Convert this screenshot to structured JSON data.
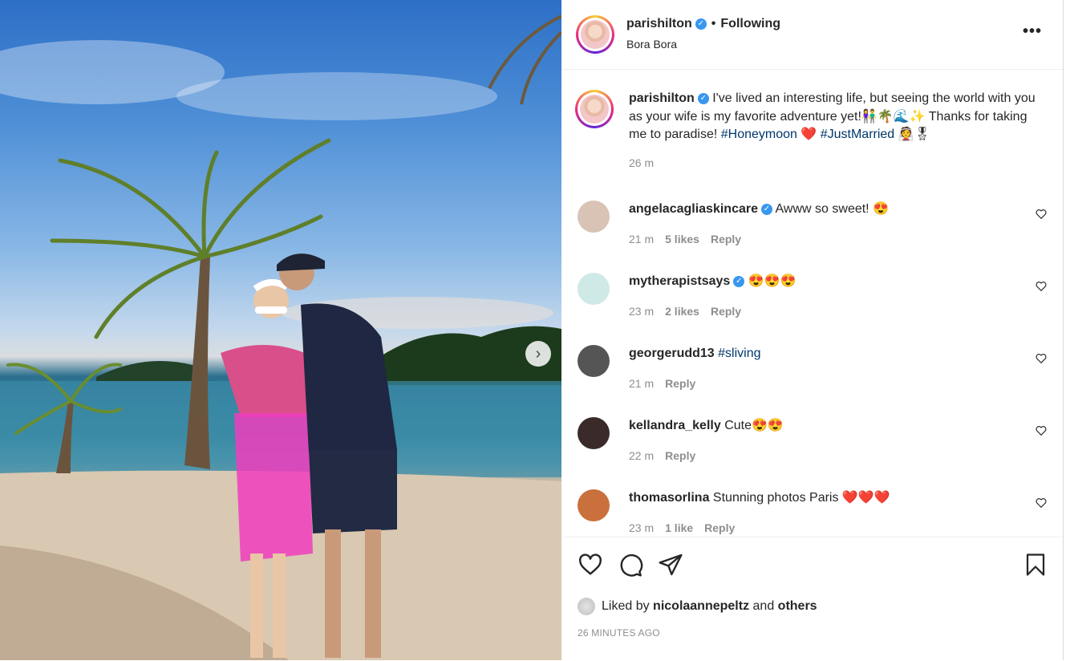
{
  "post": {
    "username": "parishilton",
    "verified_mark": "✓",
    "separator": "•",
    "following": "Following",
    "location": "Bora Bora",
    "more": "•••"
  },
  "caption": {
    "username": "parishilton",
    "text_1": "I've lived an interesting life, but seeing the world with you as your wife is my favorite adventure yet!👫🌴🌊✨ Thanks for taking me to paradise! ",
    "hashtag_1": "#Honeymoon",
    "emoji_1": " ❤️ ",
    "hashtag_2": "#JustMarried",
    "emoji_2": " 👰🎖",
    "time": "26 m"
  },
  "comments": [
    {
      "username": "angelacagliaskincare",
      "verified": true,
      "text": "Awww so sweet! 😍",
      "time": "21 m",
      "likes": "5 likes",
      "reply": "Reply",
      "avatar_color": "#d8c3b5"
    },
    {
      "username": "mytherapistsays",
      "verified": true,
      "text": "😍😍😍",
      "time": "23 m",
      "likes": "2 likes",
      "reply": "Reply",
      "avatar_color": "#cfe9e6"
    },
    {
      "username": "georgerudd13",
      "verified": false,
      "text": "",
      "hashtag": "#sliving",
      "time": "21 m",
      "likes": "",
      "reply": "Reply",
      "avatar_color": "#555555"
    },
    {
      "username": "kellandra_kelly",
      "verified": false,
      "text": "Cute😍😍",
      "time": "22 m",
      "likes": "",
      "reply": "Reply",
      "avatar_color": "#3a2a2a"
    },
    {
      "username": "thomasorlina",
      "verified": false,
      "text": "Stunning photos Paris ❤️❤️❤️",
      "time": "23 m",
      "likes": "1 like",
      "reply": "Reply",
      "avatar_color": "#c9703c"
    }
  ],
  "footer": {
    "liked_prefix": "Liked by ",
    "liked_user": "nicolaannepeltz",
    "liked_and": " and ",
    "liked_others": "others",
    "timestamp": "26 MINUTES AGO"
  },
  "photo_nav": {
    "next_arrow": "›"
  },
  "icons": {
    "like": "heart-icon",
    "comment": "comment-icon",
    "share": "share-icon",
    "save": "bookmark-icon"
  },
  "colors": {
    "verified": "#3897f0",
    "hashtag": "#00376b",
    "meta": "#8e8e8e"
  }
}
